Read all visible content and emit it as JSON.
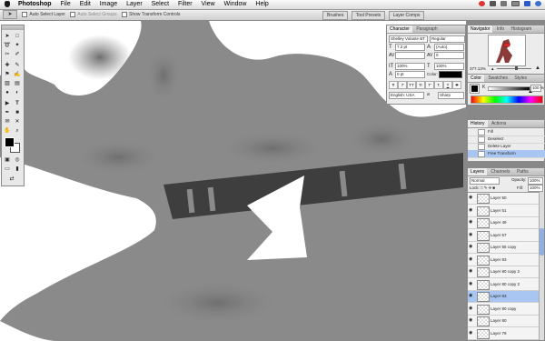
{
  "menubar": {
    "app": "Photoshop",
    "items": [
      "File",
      "Edit",
      "Image",
      "Layer",
      "Select",
      "Filter",
      "View",
      "Window",
      "Help"
    ],
    "status_icons": [
      "bluetooth-icon",
      "wifi-icon",
      "volume-icon",
      "battery-icon",
      "flag-icon",
      "user-icon"
    ]
  },
  "options": {
    "auto_select_layer": "Auto Select Layer",
    "auto_select_groups": "Auto Select Groups",
    "show_transform": "Show Transform Controls",
    "well_tabs": [
      "Brushes",
      "Tool Presets",
      "Layer Comps"
    ]
  },
  "character": {
    "tabs": [
      "Character",
      "Paragraph"
    ],
    "font": "Shelley Volante BT",
    "style": "Regular",
    "size": "7.2 pt",
    "leading": "(Auto)",
    "tracking": "0",
    "vscale": "100%",
    "hscale": "100%",
    "baseline": "0 pt",
    "color_label": "Color:",
    "style_buttons": [
      "T",
      "T",
      "TT",
      "Tr",
      "T'",
      "T,",
      "T",
      "T"
    ],
    "language": "English: USA",
    "aa_label": "a",
    "antialias": "Sharp"
  },
  "navigator": {
    "tabs": [
      "Navigator",
      "Info",
      "Histogram"
    ],
    "zoom": "377.13%"
  },
  "color_panel": {
    "tabs": [
      "Color",
      "Swatches",
      "Styles"
    ],
    "channel": "K",
    "value": "100",
    "unit": "%",
    "slider_value": 1.0
  },
  "history": {
    "tabs": [
      "History",
      "Actions"
    ],
    "items": [
      "Fill",
      "Deselect",
      "Delete Layer",
      "Free Transform"
    ],
    "selected_index": 3
  },
  "layers": {
    "tabs": [
      "Layers",
      "Channels",
      "Paths"
    ],
    "blend_mode": "Normal",
    "opacity_label": "Opacity:",
    "opacity": "100%",
    "lock_label": "Lock:",
    "fill_label": "Fill:",
    "fill": "100%",
    "rows": [
      {
        "name": "Layer 50",
        "selected": false
      },
      {
        "name": "Layer 51",
        "selected": false
      },
      {
        "name": "Layer 49",
        "selected": false
      },
      {
        "name": "Layer 57",
        "selected": false
      },
      {
        "name": "Layer 55 copy",
        "selected": false
      },
      {
        "name": "Layer 83",
        "selected": false
      },
      {
        "name": "Layer 80 copy 2",
        "selected": false
      },
      {
        "name": "Layer 80 copy 2",
        "selected": false
      },
      {
        "name": "Layer 83",
        "selected": true
      },
      {
        "name": "Layer 80 copy",
        "selected": false
      },
      {
        "name": "Layer 80",
        "selected": false
      },
      {
        "name": "Layer 79",
        "selected": false
      }
    ]
  },
  "colors": {
    "selection": "#a9c6f2",
    "panel_bg": "#ececec",
    "canvas_gray": "#8a8a8a",
    "collar": "#3e3e3e"
  }
}
